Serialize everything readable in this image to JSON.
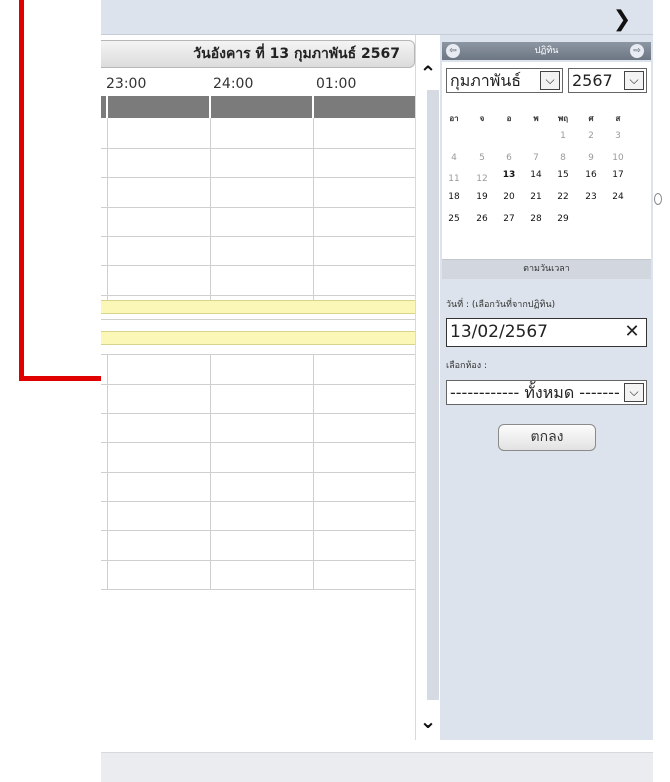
{
  "toolbar": {
    "next_icon": "chevron-right-icon"
  },
  "schedule": {
    "date_header": "วันอังคาร ที่ 13 กุมภาพันธ์ 2567",
    "times": [
      "23:00",
      "24:00",
      "01:00"
    ]
  },
  "scroll": {
    "up_icon": "chevron-up-icon",
    "down_icon": "chevron-down-icon"
  },
  "calendar": {
    "header_label": "ปฏิทิน",
    "prev_icon": "arrow-left-icon",
    "next_icon": "arrow-right-icon",
    "month_selected": "กุมภาพันธ์",
    "year_selected": "2567",
    "weekdays": [
      "อา",
      "จ",
      "อ",
      "พ",
      "พฤ",
      "ศ",
      "ส"
    ],
    "weeks": [
      [
        "",
        "",
        "",
        "",
        "1",
        "2",
        "3"
      ],
      [
        "4",
        "5",
        "6",
        "7",
        "8",
        "9",
        "10"
      ],
      [
        "11",
        "12",
        "13",
        "14",
        "15",
        "16",
        "17"
      ],
      [
        "18",
        "19",
        "20",
        "21",
        "22",
        "23",
        "24"
      ],
      [
        "25",
        "26",
        "27",
        "28",
        "29",
        "",
        ""
      ]
    ],
    "footer_label": "ตามวันเวลา"
  },
  "form": {
    "date_label": "วันที่ : (เลือกวันที่จากปฏิทิน)",
    "date_value": "13/02/2567",
    "room_label": "เลือกห้อง :",
    "room_selected": "------------ ทั้งหมด -------",
    "ok_label": "ตกลง"
  },
  "colors": {
    "annotation": "#e00000",
    "panel_bg": "#dde3ec",
    "row_highlight": "#fbf7b6",
    "header_bar": "#7b7b7b"
  }
}
